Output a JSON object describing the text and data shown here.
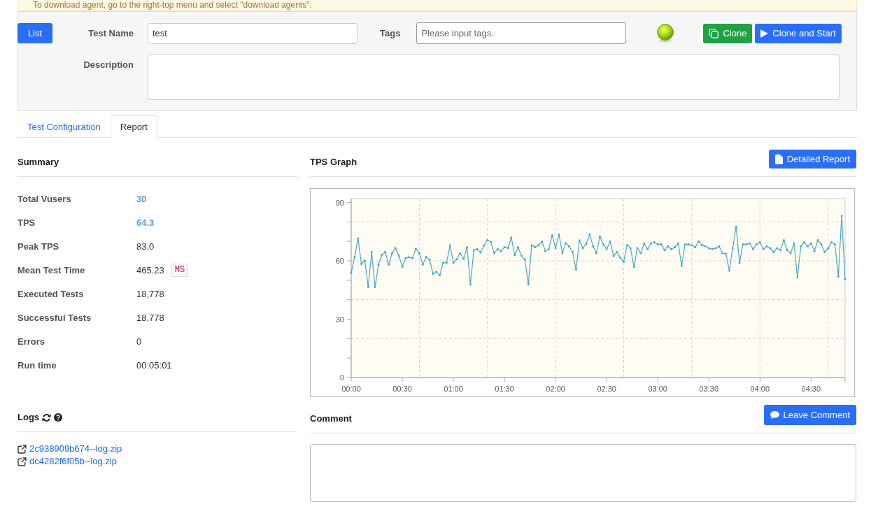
{
  "banner": {
    "text": "To download agent, go to the right-top menu and select \"download agents\"."
  },
  "form": {
    "list_button": "List",
    "test_name": {
      "label": "Test Name",
      "value": "test"
    },
    "tags": {
      "label": "Tags",
      "placeholder": "Please input tags."
    },
    "description": {
      "label": "Description"
    },
    "buttons": [
      {
        "label": "Clone",
        "kind": "clone"
      },
      {
        "label": "Clone and Start",
        "kind": "start"
      }
    ]
  },
  "tabs": [
    {
      "label": "Test Configuration",
      "selected": false
    },
    {
      "label": "Report",
      "selected": true
    }
  ],
  "summary": {
    "heading": "Summary",
    "rows": [
      {
        "label": "Total Vusers",
        "value": "30",
        "highlighted": true
      },
      {
        "label": "TPS",
        "value": "64.3",
        "highlighted": true
      },
      {
        "label": "Peak TPS",
        "value": "83.0",
        "highlighted": false
      },
      {
        "label": "Mean Test Time",
        "value": "465.23",
        "unit": "MS",
        "highlighted": false
      },
      {
        "label": "Executed Tests",
        "value": "18,778",
        "highlighted": false
      },
      {
        "label": "Successful Tests",
        "value": "18,778",
        "highlighted": false
      },
      {
        "label": "Errors",
        "value": "0",
        "highlighted": false
      },
      {
        "label": "Run time",
        "value": "00:05:01",
        "highlighted": false
      }
    ]
  },
  "tps_graph": {
    "heading": "TPS Graph",
    "button": "Detailed Report",
    "chart_data": {
      "type": "line",
      "x": [
        0,
        2,
        4,
        6,
        8,
        10,
        12,
        14,
        16,
        18,
        20,
        22,
        24,
        26,
        28,
        30,
        32,
        34,
        36,
        38,
        40,
        42,
        44,
        46,
        48,
        50,
        52,
        54,
        56,
        58,
        60,
        62,
        64,
        66,
        68,
        70,
        72,
        74,
        76,
        78,
        80,
        82,
        84,
        86,
        88,
        90,
        92,
        94,
        96,
        98,
        100,
        102,
        104,
        106,
        108,
        110,
        112,
        114,
        116,
        118,
        120,
        122,
        124,
        126,
        128,
        130,
        132,
        134,
        136,
        138,
        140,
        142,
        144,
        146,
        148,
        150,
        152,
        154,
        156,
        158,
        160,
        162,
        164,
        166,
        168,
        170,
        172,
        174,
        176,
        178,
        180,
        182,
        184,
        186,
        188,
        190,
        192,
        194,
        196,
        198,
        200,
        202,
        204,
        206,
        208,
        210,
        212,
        214,
        216,
        218,
        220,
        222,
        224,
        226,
        228,
        230,
        232,
        234,
        236,
        238,
        240,
        242,
        244,
        246,
        248,
        250,
        252,
        254,
        256,
        258,
        260,
        262,
        264,
        266,
        268,
        270,
        272,
        274,
        276,
        278,
        280,
        282,
        284,
        286,
        288,
        290
      ],
      "series": [
        {
          "color": "#4aa8bf",
          "values": [
            53.8,
            62,
            71.6,
            58.4,
            60.1,
            46.5,
            64.5,
            46.5,
            58,
            63,
            64.5,
            58,
            64,
            66.6,
            62.5,
            57,
            61.4,
            61.9,
            61.4,
            66.1,
            64,
            58,
            62,
            60.6,
            53.4,
            54.4,
            52.6,
            59,
            59,
            68,
            59,
            60.8,
            64,
            61,
            67,
            47.9,
            65.5,
            66,
            64.3,
            67.9,
            70.6,
            69.6,
            64,
            66,
            65,
            67,
            66.6,
            72,
            63,
            67,
            62.6,
            60.6,
            47.9,
            68,
            67,
            68,
            69.9,
            65,
            66,
            73.1,
            66.6,
            73.5,
            64,
            69.1,
            67.5,
            64.5,
            55.5,
            70.5,
            66.6,
            68.7,
            73.6,
            67.5,
            64,
            72.5,
            68.5,
            66,
            70,
            62.5,
            64.5,
            61.6,
            59.5,
            68.1,
            66.5,
            57,
            66.5,
            64,
            69,
            66,
            69,
            69.5,
            68.5,
            68.5,
            65.5,
            67.5,
            66,
            67,
            69,
            57.5,
            68.5,
            68.5,
            68,
            67,
            70,
            68,
            67.5,
            66.5,
            66,
            66.5,
            67.5,
            64,
            63.6,
            55,
            66.5,
            77.5,
            59,
            68.5,
            68.5,
            69,
            66,
            68.5,
            69.5,
            66,
            67.5,
            66.5,
            64.5,
            66.5,
            65.5,
            70.6,
            65.5,
            64,
            69,
            51.5,
            67.5,
            69.5,
            67.5,
            69,
            65,
            70.6,
            68.5,
            64.5,
            66.5,
            69.5,
            68.5,
            52,
            83,
            50.5
          ]
        }
      ],
      "xlim": [
        0,
        290
      ],
      "ylim": [
        0,
        92
      ],
      "xticks": [
        {
          "value": 0,
          "label": "00:00"
        },
        {
          "value": 30,
          "label": "00:30"
        },
        {
          "value": 60,
          "label": "01:00"
        },
        {
          "value": 90,
          "label": "01:30"
        },
        {
          "value": 120,
          "label": "02:00"
        },
        {
          "value": 150,
          "label": "02:30"
        },
        {
          "value": 180,
          "label": "03:00"
        },
        {
          "value": 210,
          "label": "03:30"
        },
        {
          "value": 240,
          "label": "04:00"
        },
        {
          "value": 270,
          "label": "04:30"
        }
      ],
      "yticks": [
        0,
        30,
        60,
        90
      ],
      "grid": true
    }
  },
  "logs": {
    "heading": "Logs",
    "files": [
      "2c938909b674--log.zip",
      "dc4282f6f05b--log.zip"
    ]
  },
  "comment": {
    "heading": "Comment",
    "button": "Leave Comment"
  }
}
